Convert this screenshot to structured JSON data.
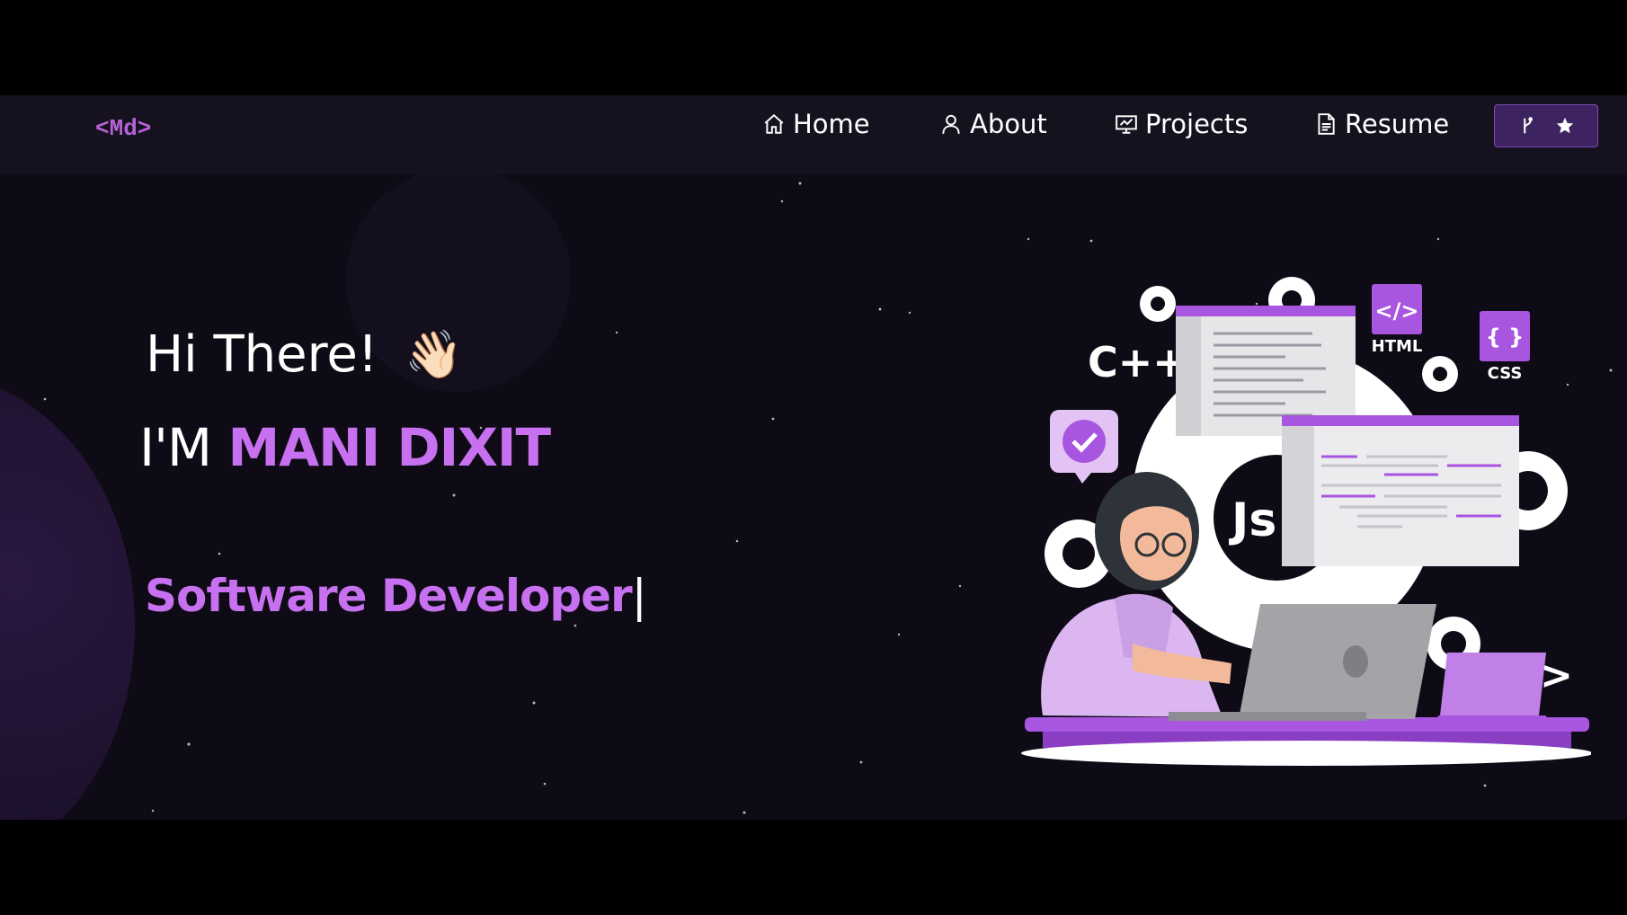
{
  "navbar": {
    "logo": "<Md>",
    "items": [
      {
        "label": "Home",
        "icon": "home-icon"
      },
      {
        "label": "About",
        "icon": "user-icon"
      },
      {
        "label": "Projects",
        "icon": "presentation-icon"
      },
      {
        "label": "Resume",
        "icon": "document-icon"
      }
    ],
    "fork_button": {
      "icons": [
        "git-fork-icon",
        "star-icon"
      ]
    }
  },
  "hero": {
    "greeting": "Hi There!",
    "wave_emoji": "👋🏻",
    "name_prefix": "I'M",
    "name": "MANI DIXIT",
    "role": "Software Developer",
    "cursor": "|"
  },
  "illustration": {
    "labels": {
      "cpp": "C++",
      "html_badge": "</>",
      "html": "HTML",
      "css_badge": "{ }",
      "css": "CSS",
      "js": "Js",
      "code_tag": "</>"
    }
  },
  "colors": {
    "accent": "#c770f0",
    "background": "#0e0b16",
    "navbar_bg": "#15111f",
    "button_bg": "#3d2461"
  }
}
